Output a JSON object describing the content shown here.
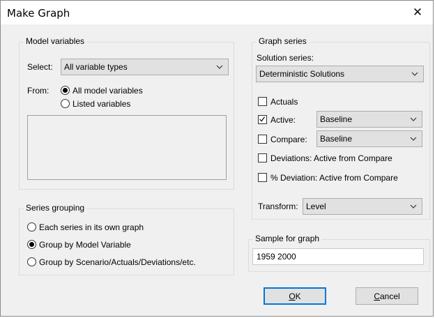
{
  "window": {
    "title": "Make Graph",
    "close_glyph": "✕"
  },
  "model_variables": {
    "legend": "Model variables",
    "select_label": "Select:",
    "select_value": "All variable types",
    "from_label": "From:",
    "from_options": [
      {
        "label": "All model variables",
        "selected": true
      },
      {
        "label": "Listed variables",
        "selected": false
      }
    ]
  },
  "series_grouping": {
    "legend": "Series grouping",
    "options": [
      {
        "label": "Each series in its own graph",
        "selected": false
      },
      {
        "label": "Group by Model Variable",
        "selected": true
      },
      {
        "label": "Group by Scenario/Actuals/Deviations/etc.",
        "selected": false
      }
    ]
  },
  "graph_series": {
    "legend": "Graph series",
    "solution_series_label": "Solution series:",
    "solution_series_value": "Deterministic Solutions",
    "actuals": {
      "label": "Actuals",
      "checked": false
    },
    "active": {
      "label": "Active:",
      "checked": true,
      "value": "Baseline"
    },
    "compare": {
      "label": "Compare:",
      "checked": false,
      "value": "Baseline"
    },
    "deviations": {
      "label": "Deviations: Active from Compare",
      "checked": false
    },
    "pct_deviation": {
      "label": "% Deviation: Active from Compare",
      "checked": false
    },
    "transform_label": "Transform:",
    "transform_value": "Level"
  },
  "sample": {
    "legend": "Sample for graph",
    "value": "1959 2000"
  },
  "buttons": {
    "ok": {
      "mnemonic": "O",
      "rest": "K"
    },
    "cancel": {
      "mnemonic": "C",
      "rest": "ancel"
    }
  },
  "icons": {
    "chevron": "chevron-down-icon",
    "check": "checkmark-icon",
    "close": "close-icon"
  },
  "colors": {
    "focus_border": "#0078d7",
    "dialog_bg": "#f0f0f0"
  }
}
